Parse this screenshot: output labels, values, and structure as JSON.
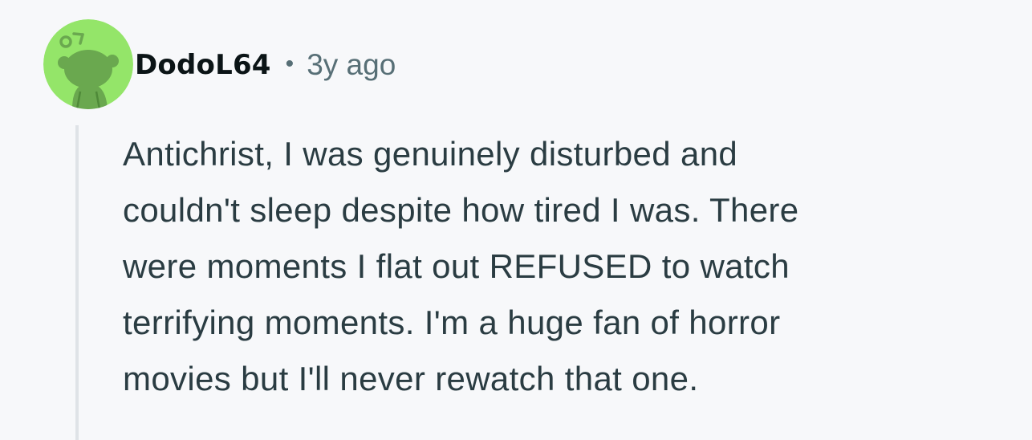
{
  "comment": {
    "author": "DodoL64",
    "separator": "•",
    "timestamp": "3y ago",
    "body": "Antichrist, I was genuinely disturbed and\ncouldn't sleep despite how tired I was. There\nwere moments I flat out REFUSED to watch\nterrifying moments. I'm a huge fan of horror\nmovies but I'll never rewatch that one.",
    "avatar_icon": "snoo-avatar-icon"
  },
  "colors": {
    "background": "#f7f8fa",
    "avatar_bg": "#94e569",
    "avatar_figure": "#6aa84f",
    "username": "#0b1416",
    "meta": "#576f76",
    "body_text": "#2a3c42",
    "thread_line": "#dfe3e7"
  }
}
